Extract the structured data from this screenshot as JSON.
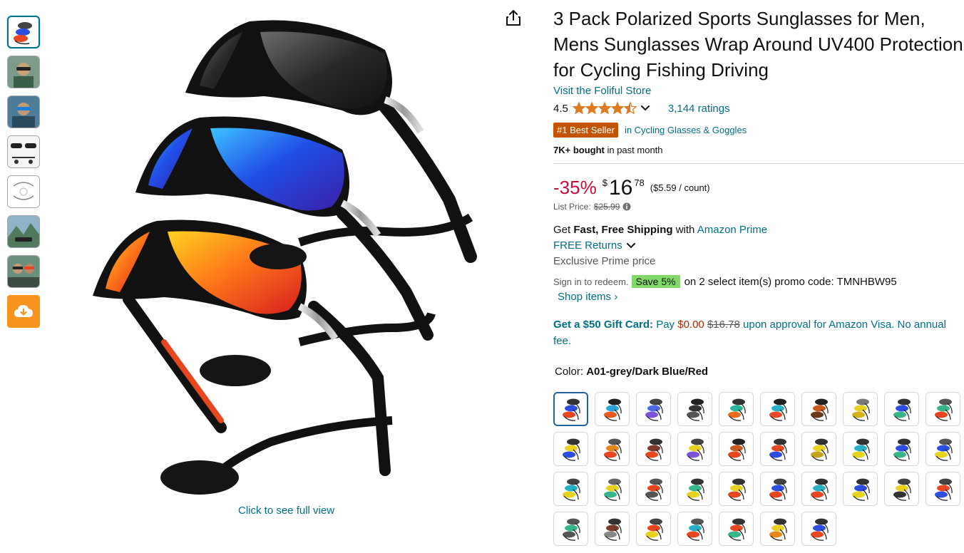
{
  "product": {
    "title": "3 Pack Polarized Sports Sunglasses for Men, Mens Sunglasses Wrap Around UV400 Protection for Cycling Fishing Driving",
    "store_link": "Visit the Foliful Store",
    "rating": "4.5",
    "ratings_count": "3,144 ratings",
    "best_seller_badge": "#1 Best Seller",
    "best_seller_category": "in Cycling Glasses & Goggles",
    "bought_bold": "7K+ bought",
    "bought_rest": " in past month"
  },
  "price": {
    "discount": "-35%",
    "symbol": "$",
    "whole": "16",
    "fraction": "78",
    "unit": "($5.59 / count)",
    "list_label": "List Price:",
    "list_value": "$25.99"
  },
  "shipping": {
    "get": "Get ",
    "fast": "Fast, Free Shipping",
    "with": " with ",
    "prime_link": "Amazon Prime",
    "returns": "FREE Returns",
    "prime_price": "Exclusive Prime price"
  },
  "promo": {
    "sign_in": "Sign in to redeem.",
    "save_badge": "Save 5%",
    "text": "on 2 select item(s) promo code: TMNHBW95",
    "shop_items": "Shop items ›"
  },
  "gift_card": {
    "bold": "Get a $50 Gift Card:",
    "pay": " Pay ",
    "new_price": "$0.00",
    "old_price": "$16.78",
    "rest": " upon approval for Amazon Visa. No annual fee."
  },
  "color": {
    "label": "Color: ",
    "value": "A01-grey/Dark Blue/Red",
    "swatches": [
      [
        "#333",
        "#2b4de0",
        "#e8461e"
      ],
      [
        "#222",
        "#29a3d9",
        "#e85a1c"
      ],
      [
        "#444",
        "#4c6be8",
        "#7b52d9"
      ],
      [
        "#222",
        "#333",
        "#555"
      ],
      [
        "#333",
        "#27b59a",
        "#e86d1c"
      ],
      [
        "#222",
        "#29b0c9",
        "#e84a2a"
      ],
      [
        "#222",
        "#c85a1c",
        "#6b3a1a"
      ],
      [
        "#777",
        "#e8d21e",
        "#d4b21e"
      ],
      [
        "#333",
        "#2b4de0",
        "#37b58b"
      ],
      [
        "#555",
        "#37b58b",
        "#e8461e"
      ],
      [
        "#333",
        "#e8d21e",
        "#2b4de0"
      ],
      [
        "#555",
        "#e8861e",
        "#e8461e"
      ],
      [
        "#333",
        "#7b3a2a",
        "#e8461e"
      ],
      [
        "#444",
        "#e8d21e",
        "#7b52d9"
      ],
      [
        "#222",
        "#c85a1c",
        "#e8461e"
      ],
      [
        "#333",
        "#e8461e",
        "#2b4de0"
      ],
      [
        "#333",
        "#e8d21e",
        "#c8a21e"
      ],
      [
        "#333",
        "#29b0c9",
        "#e8d21e"
      ],
      [
        "#333",
        "#2b4de0",
        "#37b58b"
      ],
      [
        "#555",
        "#2b4de0",
        "#e8d21e"
      ],
      [
        "#444",
        "#29b0c9",
        "#e8d21e"
      ],
      [
        "#666",
        "#e8d21e",
        "#37b58b"
      ],
      [
        "#555",
        "#e8461e",
        "#555"
      ],
      [
        "#333",
        "#37b58b",
        "#e8d21e"
      ],
      [
        "#333",
        "#e8d21e",
        "#e8461e"
      ],
      [
        "#444",
        "#2b4de0",
        "#e8461e"
      ],
      [
        "#333",
        "#29b0c9",
        "#e8461e"
      ],
      [
        "#333",
        "#2b4de0",
        "#e8d21e"
      ],
      [
        "#444",
        "#e8d21e",
        "#333"
      ],
      [
        "#444",
        "#e8461e",
        "#2b4de0"
      ],
      [
        "#555",
        "#37b58b",
        "#555"
      ],
      [
        "#333",
        "#7b3a2a",
        "#888"
      ],
      [
        "#444",
        "#e8461e",
        "#e8d21e"
      ],
      [
        "#555",
        "#29b0c9",
        "#e8461e"
      ],
      [
        "#333",
        "#e8461e",
        "#37b58b"
      ],
      [
        "#333",
        "#e8d21e",
        "#e8861e"
      ],
      [
        "#333",
        "#2b4de0",
        "#e8461e"
      ]
    ]
  },
  "gallery": {
    "full_view": "Click to see full view"
  },
  "icons": {
    "share": "share-icon",
    "cloud_download": "cloud-download-icon"
  },
  "colors": {
    "link": "#007185",
    "best_seller": "#c45500",
    "discount": "#cc0c39",
    "star": "#de7921",
    "save_badge": "#7fda69",
    "cloud_button": "#f7941d"
  }
}
